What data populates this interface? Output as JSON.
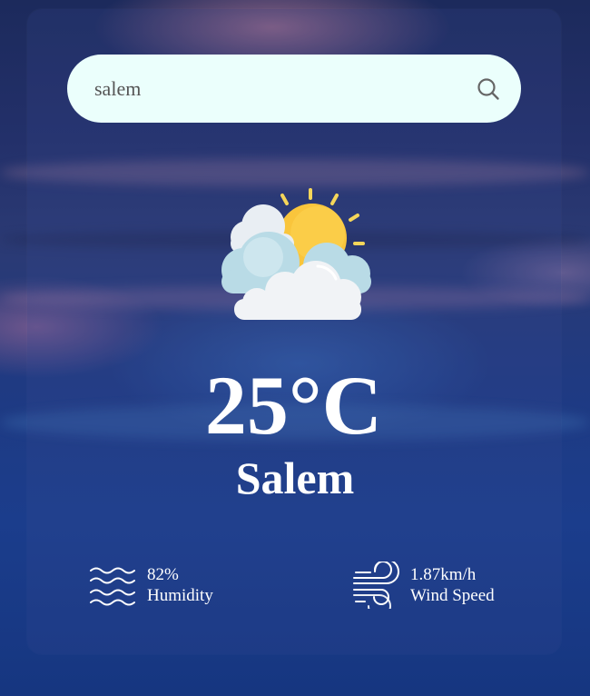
{
  "search": {
    "value": "salem",
    "button_icon": "search-icon"
  },
  "weather": {
    "icon": "partly-cloudy-sun-icon",
    "temperature": "25°C",
    "city": "Salem"
  },
  "details": {
    "humidity": {
      "icon": "humidity-waves-icon",
      "value": "82%",
      "label": "Humidity"
    },
    "wind": {
      "icon": "wind-icon",
      "value": "1.87km/h",
      "label": "Wind Speed"
    }
  },
  "colors": {
    "search_bg": "#ebfffc",
    "text": "#ffffff",
    "sun": "#f9c53c",
    "cloud": "#e8edf2",
    "cloud_shade": "#b9dbe6"
  }
}
